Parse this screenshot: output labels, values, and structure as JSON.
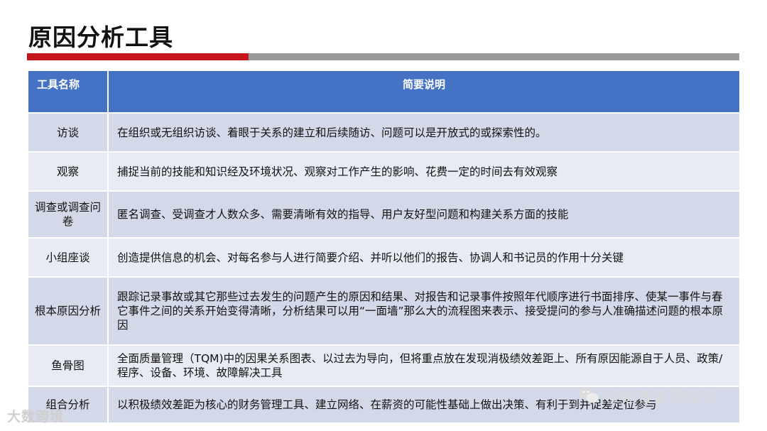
{
  "page": {
    "title": "原因分析工具"
  },
  "table": {
    "headers": [
      "工具名称",
      "简要说明"
    ],
    "rows": [
      {
        "name": "访谈",
        "desc": "在组织或无组织访谈、着眼于关系的建立和后续随访、问题可以是开放式的或探索性的。"
      },
      {
        "name": "观察",
        "desc": "捕捉当前的技能和知识经及环境状况、观察对工作产生的影响、花费一定的时间去有效观察"
      },
      {
        "name": "调查或调查问卷",
        "desc": "匿名调查、受调查才人数众多、需要清晰有效的指导、用户友好型问题和构建关系方面的技能"
      },
      {
        "name": "小组座谈",
        "desc": "创造提供信息的机会、对每名参与人进行简要介绍、并听以他们的报告、协调人和书记员的作用十分关键"
      },
      {
        "name": "根本原因分析",
        "desc": "跟踪记录事故或其它那些过去发生的问题产生的原因和结果、对报告和记录事件按照年代顺序进行书面排序、使某一事件与春它事件之间的关系开始变得清晰，分析结果可以用“一面墙”那么大的流程图来表示、接受提问的参与人准确描述问题的根本原因"
      },
      {
        "name": "鱼骨图",
        "desc": "全面质量管理（TQM)中的因果关系图表、以过去为导向，但将重点放在发现消极绩效差距上、所有原因能源自于人员、政策/程序、设备、环境、故障解决工具"
      },
      {
        "name": "组合分析",
        "desc": "以积极绩效差距为核心的财务管理工具、建立网络、在薪资的可能性基础上做出决策、有利于到并促差定位参与"
      }
    ]
  },
  "watermarks": {
    "left": "大数跨境",
    "right": "领导者管理笔记",
    "right_icon": "wechat-icon"
  },
  "colors": {
    "accent_red": "#c4161c",
    "bar_gray": "#9a9a9a",
    "header_blue": "#4472c4",
    "row_dark": "#d3d9e9",
    "row_light": "#e8ebf4"
  }
}
